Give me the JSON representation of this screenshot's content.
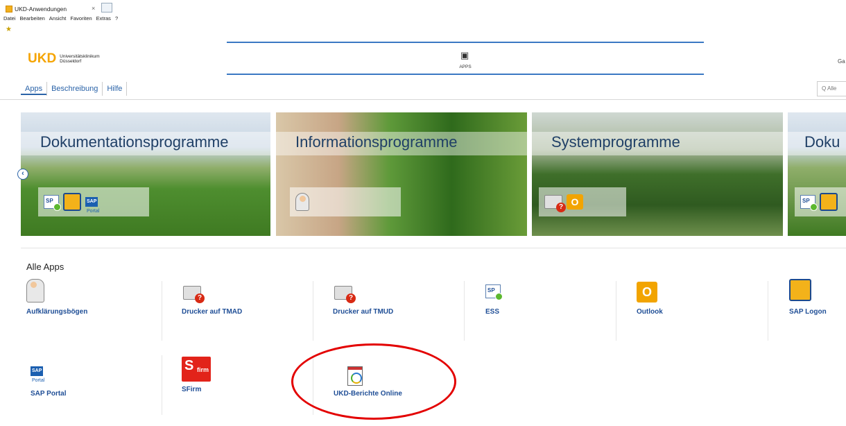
{
  "browser": {
    "tab_title": "UKD-Anwendungen",
    "menu": [
      "Datei",
      "Bearbeiten",
      "Ansicht",
      "Favoriten",
      "Extras",
      "?"
    ]
  },
  "header": {
    "logo_text": "UKD",
    "logo_sub_line1": "Universitätsklinikum",
    "logo_sub_line2": "Düsseldorf",
    "center_label": "APPS",
    "user_initials": "Ga"
  },
  "nav": {
    "tabs": [
      "Apps",
      "Beschreibung",
      "Hilfe"
    ],
    "search_placeholder": "Alle"
  },
  "carousel": {
    "tiles": [
      {
        "title": "Dokumentationsprogramme"
      },
      {
        "title": "Informationsprogramme"
      },
      {
        "title": "Systemprogramme"
      },
      {
        "title": "Doku"
      }
    ],
    "sap_portal_icon_text": "SAP",
    "sap_portal_small_text": "Portal"
  },
  "all_apps": {
    "title": "Alle Apps",
    "apps": [
      {
        "name": "Aufklärungsbögen",
        "icon": "person-icon"
      },
      {
        "name": "Drucker auf TMAD",
        "icon": "printer-icon"
      },
      {
        "name": "Drucker auf TMUD",
        "icon": "printer-icon"
      },
      {
        "name": "ESS",
        "icon": "sp-icon"
      },
      {
        "name": "Outlook",
        "icon": "outlook-icon"
      },
      {
        "name": "SAP Logon",
        "icon": "sap-logon-icon"
      },
      {
        "name": "SAP Portal",
        "icon": "sap-portal-icon"
      },
      {
        "name": "SFirm",
        "icon": "sfirm-icon"
      },
      {
        "name": "UKD-Berichte Online",
        "icon": "report-icon"
      }
    ],
    "sfirm_icon_text": "firm",
    "sfirm_icon_letter": "S",
    "outlook_icon_letter": "O",
    "highlight_color": "#e30000"
  }
}
